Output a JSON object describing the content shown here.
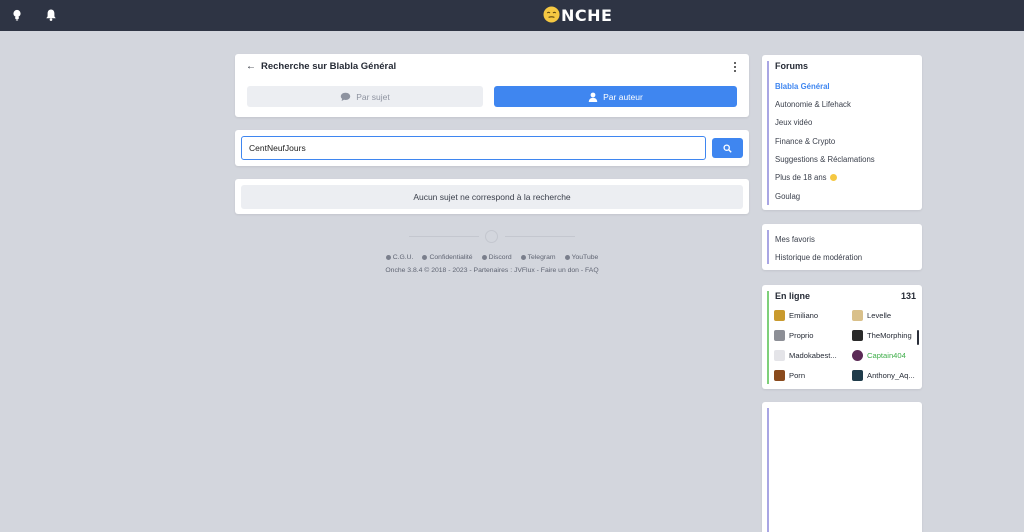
{
  "topbar": {
    "logo_text": "NCHE",
    "icons": [
      "lightbulb-icon",
      "bell-icon",
      "onche-smiley-logo"
    ]
  },
  "search": {
    "title": "Recherche sur Blabla Général",
    "tab_subject": "Par sujet",
    "tab_author": "Par auteur",
    "query": "CentNeufJours",
    "empty_message": "Aucun sujet ne correspond à la recherche"
  },
  "footer": {
    "links": [
      "C.G.U.",
      "Confidentialité",
      "Discord",
      "Telegram",
      "YouTube"
    ],
    "version": "Onche 3.8.4 © 2018 - 2023",
    "partners_label": "- Partenaires :",
    "partner": "JVFlux",
    "donate": "- Faire un don",
    "faq": "- FAQ"
  },
  "sidebar": {
    "forums_title": "Forums",
    "forums": [
      "Blabla Général",
      "Autonomie & Lifehack",
      "Jeux vidéo",
      "Finance & Crypto",
      "Suggestions & Réclamations",
      "Plus de 18 ans",
      "Goulag"
    ],
    "active_forum": "Blabla Général",
    "extras": [
      "Mes favoris",
      "Historique de modération"
    ],
    "online_title": "En ligne",
    "online_count": "131",
    "online_users": [
      "Emiliano",
      "Levelle",
      "Proprio",
      "TheMorphing",
      "Madokabest...",
      "Captain404",
      "Porn",
      "Anthony_Aq..."
    ]
  },
  "colors": {
    "topbar": "#2e3444",
    "background": "#d3d6dd",
    "accent_blue": "#3f86f0",
    "sidebar_accent": "#a9a6e4",
    "online_green": "#3fae4a"
  }
}
